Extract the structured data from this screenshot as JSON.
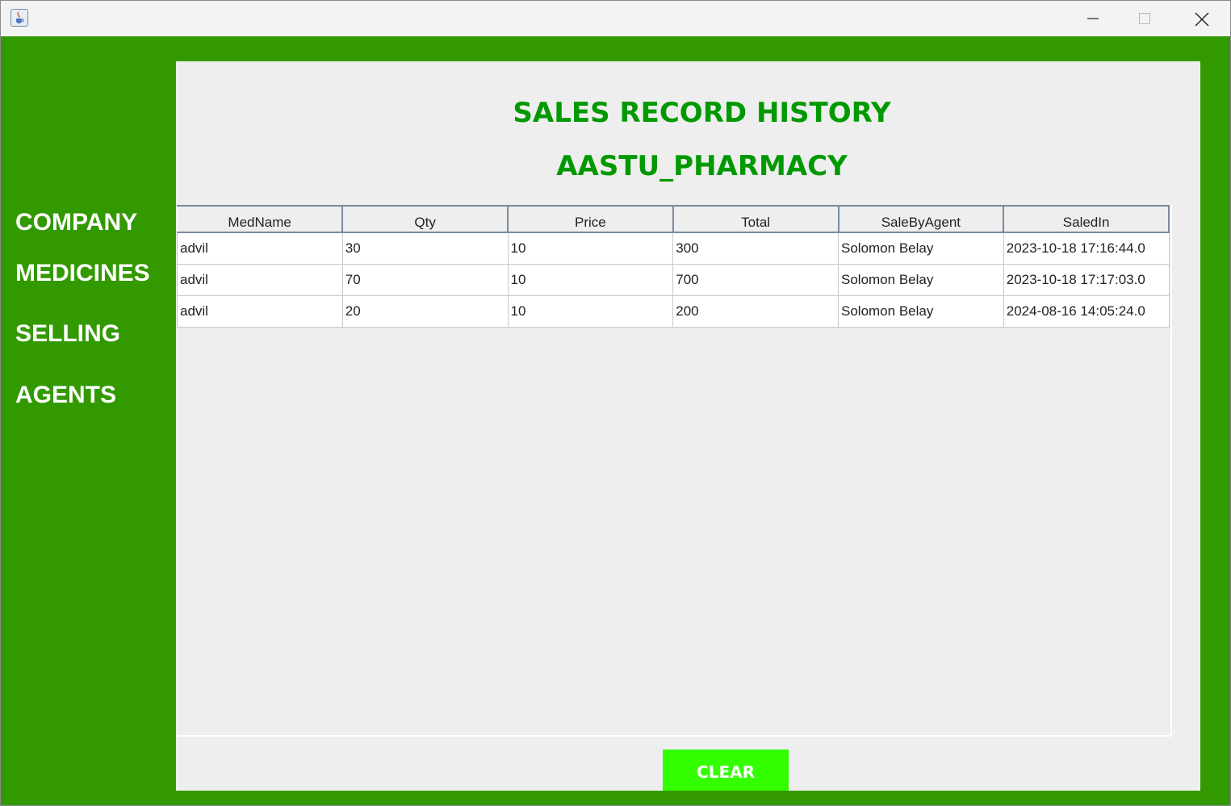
{
  "window": {
    "app_icon": "java-cup-icon"
  },
  "sidebar": {
    "items": [
      {
        "label": "COMPANY"
      },
      {
        "label": "MEDICINES"
      },
      {
        "label": "SELLING"
      },
      {
        "label": "AGENTS"
      }
    ]
  },
  "main": {
    "title": "SALES RECORD HISTORY",
    "subtitle": "AASTU_PHARMACY",
    "table": {
      "columns": [
        "MedName",
        "Qty",
        "Price",
        "Total",
        "SaleByAgent",
        "SaledIn"
      ],
      "rows": [
        [
          "advil",
          "30",
          "10",
          "300",
          "Solomon Belay",
          "2023-10-18 17:16:44.0"
        ],
        [
          "advil",
          "70",
          "10",
          "700",
          "Solomon Belay",
          "2023-10-18 17:17:03.0"
        ],
        [
          "advil",
          "20",
          "10",
          "200",
          "Solomon Belay",
          "2024-08-16 14:05:24.0"
        ]
      ]
    },
    "clear_label": "CLEAR"
  },
  "colors": {
    "frame_green": "#339900",
    "title_green": "#009900",
    "button_green": "#33ff00",
    "panel_gray": "#eeeeee"
  }
}
